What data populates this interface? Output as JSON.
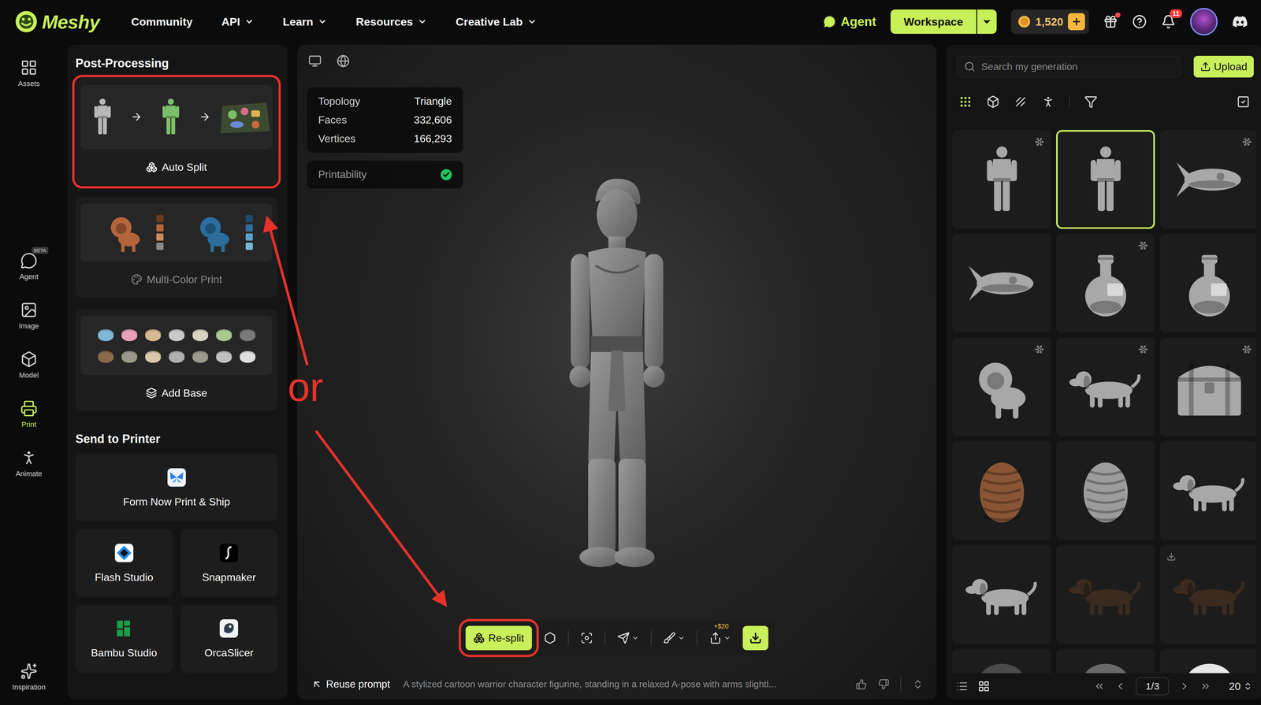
{
  "nav": {
    "logo": "Meshy",
    "links": [
      {
        "label": "Community",
        "dropdown": false
      },
      {
        "label": "API",
        "dropdown": true
      },
      {
        "label": "Learn",
        "dropdown": true
      },
      {
        "label": "Resources",
        "dropdown": true
      },
      {
        "label": "Creative Lab",
        "dropdown": true
      }
    ],
    "agent": "Agent",
    "workspace": "Workspace",
    "credits": "1,520",
    "gift_dot": true,
    "notifications": "11"
  },
  "rail": {
    "top": [
      {
        "label": "Assets",
        "kind": "assets",
        "selected": false,
        "badge": ""
      }
    ],
    "main": [
      {
        "label": "Agent",
        "kind": "agent",
        "selected": false,
        "badge": "BETA"
      },
      {
        "label": "Image",
        "kind": "image",
        "selected": false,
        "badge": ""
      },
      {
        "label": "Model",
        "kind": "model",
        "selected": false,
        "badge": ""
      },
      {
        "label": "Print",
        "kind": "print",
        "selected": true,
        "badge": ""
      },
      {
        "label": "Animate",
        "kind": "animate",
        "selected": false,
        "badge": ""
      }
    ],
    "bottom": [
      {
        "label": "Inspiration",
        "kind": "inspiration",
        "selected": false,
        "badge": ""
      }
    ]
  },
  "left_panel": {
    "title": "Post-Processing",
    "tools": [
      {
        "label": "Auto Split",
        "kind": "split",
        "disabled": false,
        "annotated": true
      },
      {
        "label": "Multi-Color Print",
        "kind": "color",
        "disabled": true,
        "annotated": false
      },
      {
        "label": "Add Base",
        "kind": "base",
        "disabled": false,
        "annotated": false
      }
    ],
    "printer_title": "Send to Printer",
    "printers": [
      {
        "label": "Form Now Print & Ship",
        "kind": "formnow"
      },
      {
        "label": "Flash Studio",
        "kind": "flash"
      },
      {
        "label": "Snapmaker",
        "kind": "snapmaker"
      },
      {
        "label": "Bambu Studio",
        "kind": "bambu"
      },
      {
        "label": "OrcaSlicer",
        "kind": "orca"
      }
    ]
  },
  "viewer": {
    "stats": [
      {
        "label": "Topology",
        "value": "Triangle"
      },
      {
        "label": "Faces",
        "value": "332,606"
      },
      {
        "label": "Vertices",
        "value": "166,293"
      }
    ],
    "printability": {
      "label": "Printability",
      "ok": true
    },
    "toolbar": {
      "primary": "Re-split",
      "annotated": true,
      "price_tag": "+$20"
    },
    "prompt": {
      "action": "Reuse prompt",
      "text": "A stylized cartoon warrior character figurine, standing in a relaxed A-pose with arms slightl..."
    }
  },
  "annotation": {
    "text": "or"
  },
  "library": {
    "search_placeholder": "Search my generation",
    "upload": "Upload",
    "filters": [
      {
        "kind": "all",
        "selected": true
      },
      {
        "kind": "model",
        "selected": false
      },
      {
        "kind": "texture",
        "selected": false
      },
      {
        "kind": "animation",
        "selected": false
      }
    ],
    "items": [
      {
        "kind": "figure",
        "color": "#a8a8a8",
        "selected": false,
        "badge": "split"
      },
      {
        "kind": "figure",
        "color": "#a8a8a8",
        "selected": true,
        "badge": "none"
      },
      {
        "kind": "rocket",
        "color": "#a8a8a8",
        "selected": false,
        "badge": "split"
      },
      {
        "kind": "rocket",
        "color": "#a8a8a8",
        "selected": false,
        "badge": "none"
      },
      {
        "kind": "potion",
        "color": "#a8a8a8",
        "selected": false,
        "badge": "split"
      },
      {
        "kind": "potion",
        "color": "#a8a8a8",
        "selected": false,
        "badge": "none"
      },
      {
        "kind": "lion",
        "color": "#a8a8a8",
        "selected": false,
        "badge": "split"
      },
      {
        "kind": "dog",
        "color": "#a8a8a8",
        "selected": false,
        "badge": "split"
      },
      {
        "kind": "chest",
        "color": "#a8a8a8",
        "selected": false,
        "badge": "split"
      },
      {
        "kind": "pinecone",
        "color": "#8a5534",
        "selected": false,
        "badge": "none"
      },
      {
        "kind": "pinecone",
        "color": "#9c9c9c",
        "selected": false,
        "badge": "none"
      },
      {
        "kind": "dog",
        "color": "#a8a8a8",
        "selected": false,
        "badge": "none"
      },
      {
        "kind": "dog",
        "color": "#a8a8a8",
        "selected": false,
        "badge": "none"
      },
      {
        "kind": "dog",
        "color": "#3a2a1f",
        "selected": false,
        "badge": "none"
      },
      {
        "kind": "dog",
        "color": "#3a2a1f",
        "selected": false,
        "badge": "download"
      },
      {
        "kind": "blob",
        "color": "#4a4a4a",
        "selected": false,
        "badge": "none"
      },
      {
        "kind": "blob",
        "color": "#6a6a6a",
        "selected": false,
        "badge": "none"
      },
      {
        "kind": "blob",
        "color": "#e8e8e8",
        "selected": false,
        "badge": "none"
      }
    ],
    "view": [
      {
        "kind": "list",
        "selected": false
      },
      {
        "kind": "grid",
        "selected": true
      }
    ],
    "page": "1/3",
    "page_size": "20"
  }
}
